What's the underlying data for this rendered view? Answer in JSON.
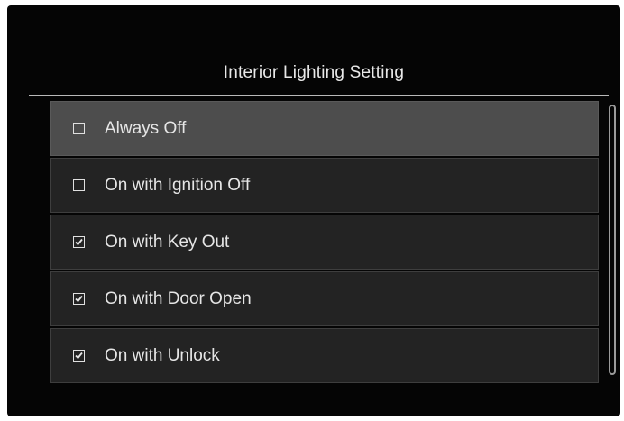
{
  "screen": {
    "title": "Interior Lighting Setting"
  },
  "options": [
    {
      "label": "Always Off",
      "checked": false,
      "selected": true
    },
    {
      "label": "On with Ignition Off",
      "checked": false,
      "selected": false
    },
    {
      "label": "On with Key Out",
      "checked": true,
      "selected": false
    },
    {
      "label": "On with Door Open",
      "checked": true,
      "selected": false
    },
    {
      "label": "On with Unlock",
      "checked": true,
      "selected": false
    }
  ],
  "colors": {
    "background": "#050505",
    "row": "#232323",
    "row_selected": "#4d4d4d",
    "text": "#e6e6e6"
  }
}
